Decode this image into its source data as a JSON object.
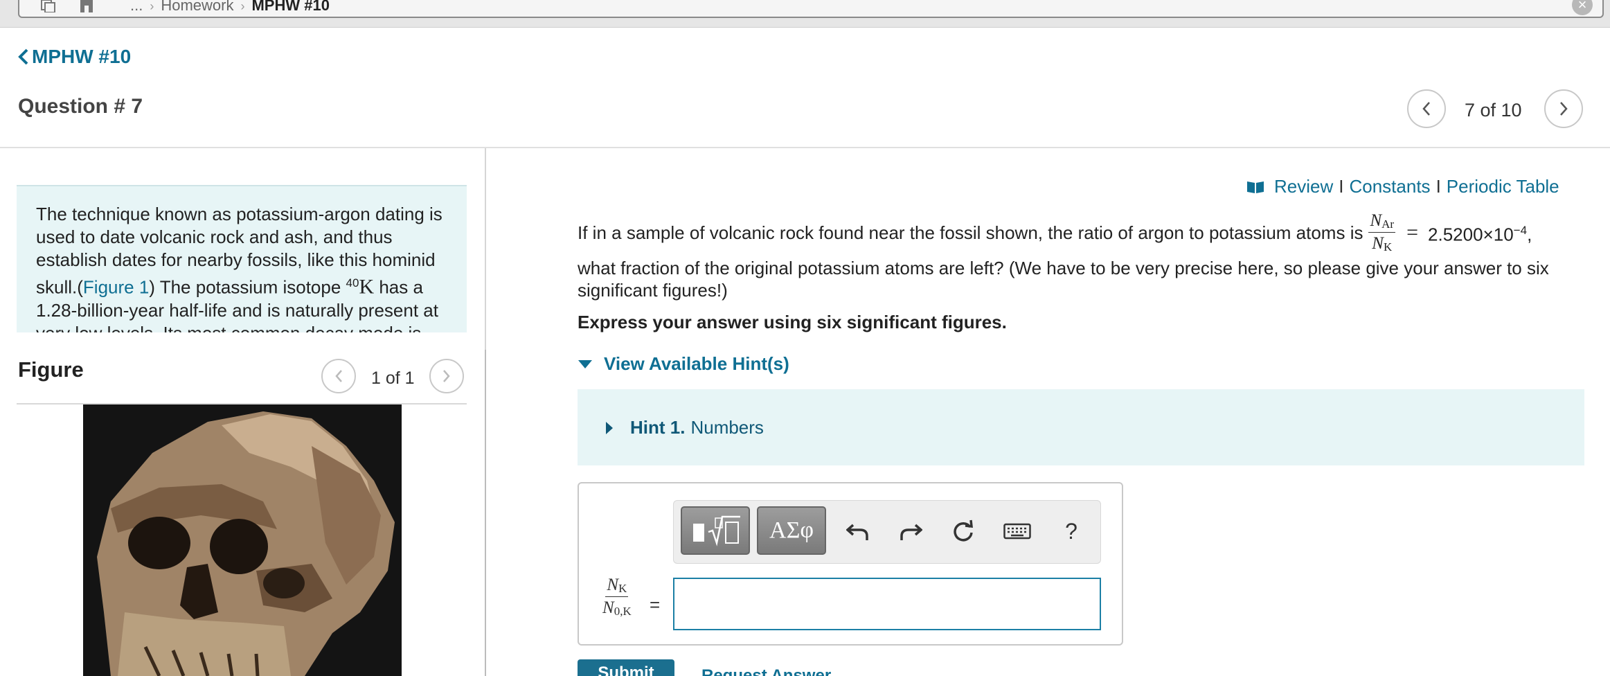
{
  "topbar": {
    "breadcrumb_ellipsis": "...",
    "breadcrumb_parent": "Homework",
    "breadcrumb_current": "MPHW #10"
  },
  "header": {
    "back_label": "MPHW #10",
    "question_title": "Question # 7",
    "question_counter": "7 of 10"
  },
  "intro": {
    "text_1": "The technique known as potassium-argon dating is used to date volcanic rock and ash, and thus establish dates for nearby fossils, like this hominid skull.(",
    "figure_link": "Figure 1",
    "text_2": ") The potassium isotope ",
    "isotope_mass": "40",
    "isotope_symbol": "K",
    "text_3": " has a 1.28-billion-year half-life and is naturally present at very low levels. Its most common decay mode is"
  },
  "figure": {
    "title": "Figure",
    "counter": "1 of 1"
  },
  "resources": {
    "review": "Review",
    "constants": "Constants",
    "periodic_table": "Periodic Table",
    "separator": "I"
  },
  "problem": {
    "text_before": "If in a sample of volcanic rock found near the fossil shown, the ratio of argon to potassium atoms is",
    "ratio_num": "N",
    "ratio_num_sub": "Ar",
    "ratio_den": "N",
    "ratio_den_sub": "K",
    "equals": "=",
    "value_mantissa": "2.5200×10",
    "value_exp": "−4",
    "value_suffix": ",",
    "text_after": "what fraction of the original potassium atoms are left?  (We have to be very precise here, so please give your answer to six significant figures!)",
    "instruction": "Express your answer using six significant figures."
  },
  "hints": {
    "toggle_label": "View Available Hint(s)",
    "hint_number": "Hint 1.",
    "hint_title": "Numbers"
  },
  "answer": {
    "label_num": "N",
    "label_num_sub": "K",
    "label_den": "N",
    "label_den_sub": "0,K",
    "equals": "=",
    "input_value": "",
    "greek_label": "ΑΣφ",
    "help_label": "?"
  },
  "actions": {
    "submit": "Submit",
    "request_answer": "Request Answer"
  },
  "colors": {
    "accent": "#0f6f93",
    "hint_bg": "#e7f5f6",
    "input_border": "#1b7fa5"
  }
}
